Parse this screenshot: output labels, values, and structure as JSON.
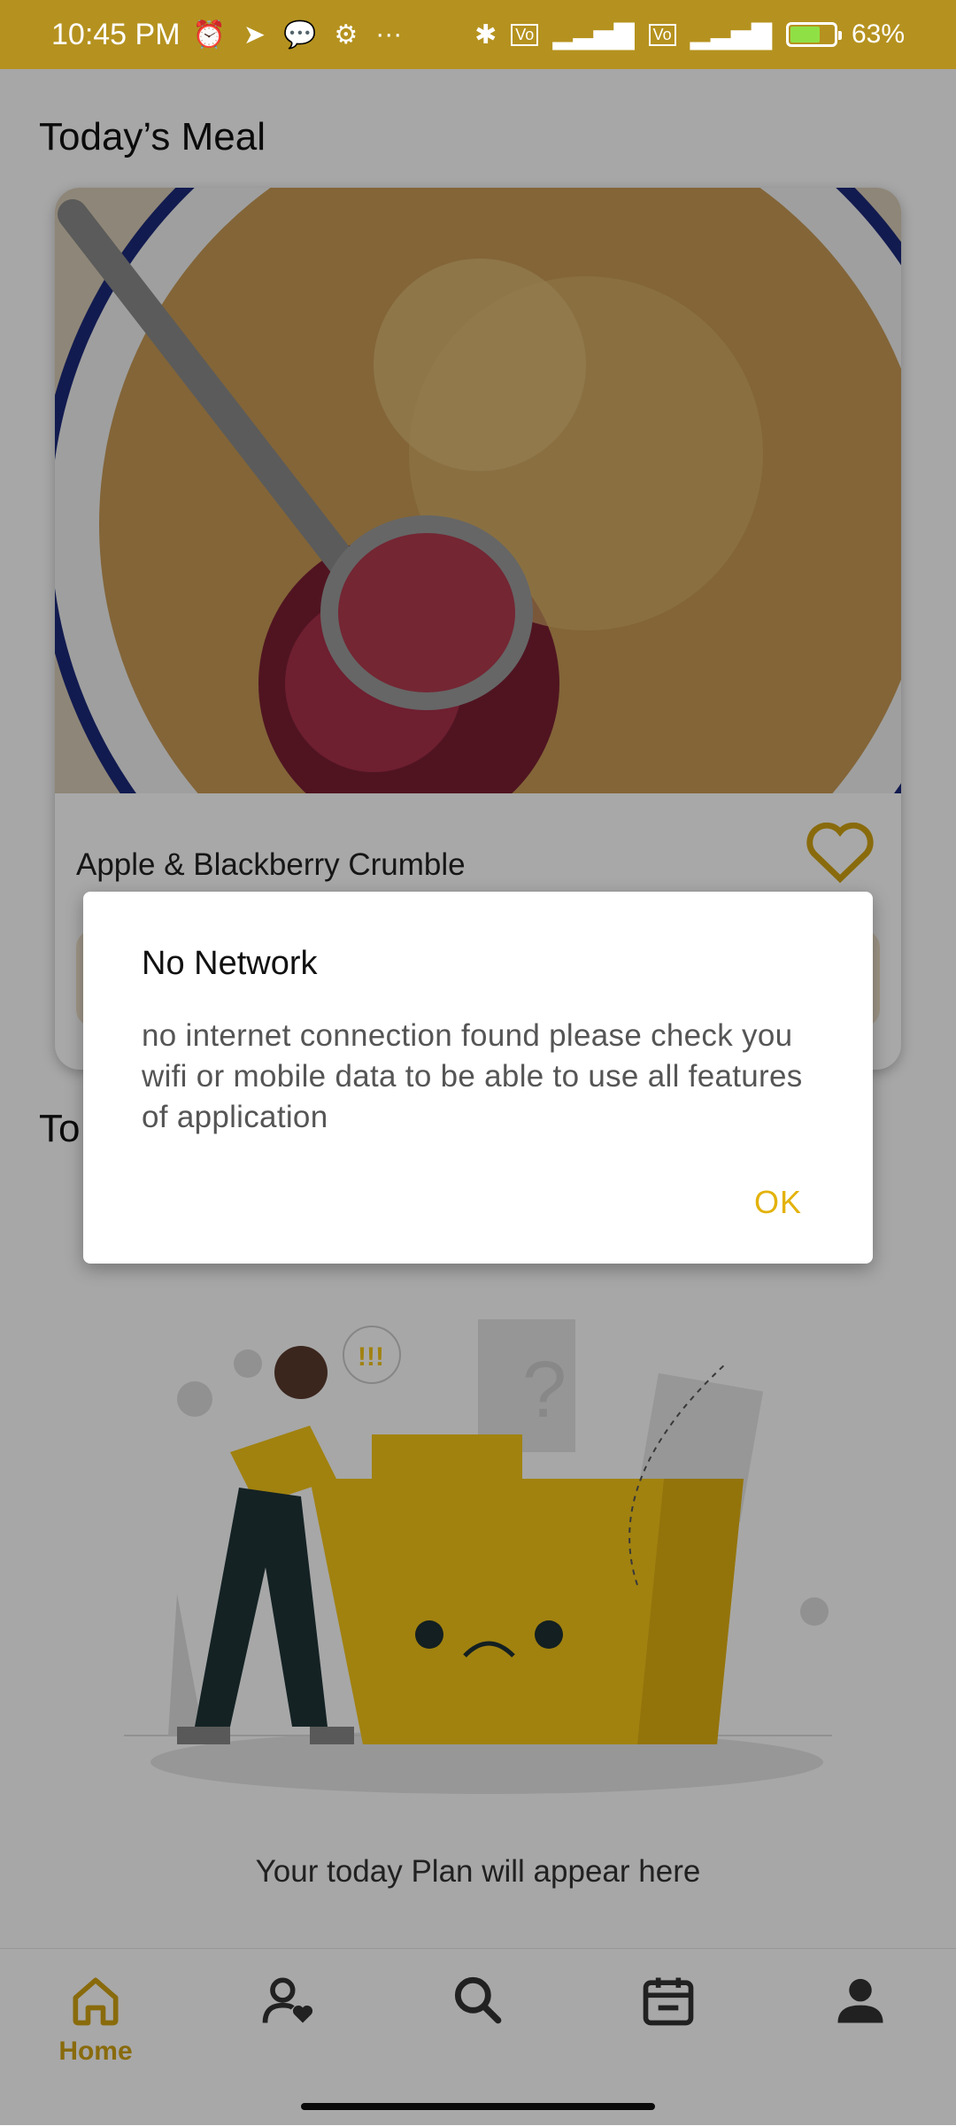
{
  "status_bar": {
    "time": "10:45 PM",
    "battery": "63%",
    "battery_level": 0.63,
    "icons_left": [
      "alarm-icon",
      "telegram-icon",
      "chat-icon",
      "settings-icon",
      "more-icon"
    ],
    "icons_right": [
      "bluetooth-icon",
      "volte-icon",
      "signal-icon",
      "volte-icon",
      "signal-icon",
      "battery-icon"
    ]
  },
  "home": {
    "todays_meal_title": "Today’s Meal",
    "todays_plan_title_partial": "To",
    "meal_name": "Apple & Blackberry Crumble",
    "empty_plan_text": "Your today Plan will appear here"
  },
  "dialog": {
    "title": "No Network",
    "message": "no internet connection found please check you wifi or mobile data to be able to use all features of application",
    "ok_label": "OK"
  },
  "bottom_nav": {
    "items": [
      {
        "icon": "home-icon",
        "label": "Home",
        "active": true
      },
      {
        "icon": "favorites-user-icon",
        "label": "",
        "active": false
      },
      {
        "icon": "search-icon",
        "label": "",
        "active": false
      },
      {
        "icon": "calendar-icon",
        "label": "",
        "active": false
      },
      {
        "icon": "profile-icon",
        "label": "",
        "active": false
      }
    ]
  },
  "colors": {
    "accent": "#d1a313",
    "status_bar": "#b5921f",
    "ok_text": "#e3b20b"
  }
}
